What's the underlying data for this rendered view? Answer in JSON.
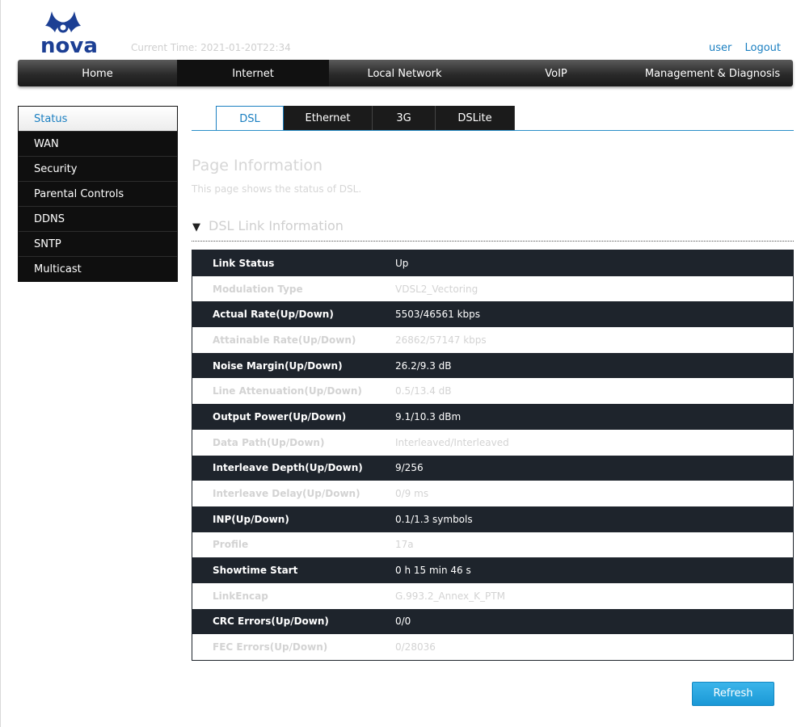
{
  "brand": {
    "logo_text": "nova"
  },
  "header": {
    "current_time": "Current Time: 2021-01-20T22:34",
    "user_label": "user",
    "logout_label": "Logout"
  },
  "topnav": {
    "tabs": [
      {
        "label": "Home"
      },
      {
        "label": "Internet"
      },
      {
        "label": "Local Network"
      },
      {
        "label": "VoIP"
      },
      {
        "label": "Management & Diagnosis"
      }
    ],
    "active_index": 1
  },
  "sidebar": {
    "items": [
      {
        "label": "Status"
      },
      {
        "label": "WAN"
      },
      {
        "label": "Security"
      },
      {
        "label": "Parental Controls"
      },
      {
        "label": "DDNS"
      },
      {
        "label": "SNTP"
      },
      {
        "label": "Multicast"
      }
    ],
    "active_index": 0
  },
  "subtabs": {
    "tabs": [
      {
        "label": "DSL"
      },
      {
        "label": "Ethernet"
      },
      {
        "label": "3G"
      },
      {
        "label": "DSLite"
      }
    ],
    "active_index": 0
  },
  "page": {
    "title": "Page Information",
    "description": "This page shows the status of DSL."
  },
  "section": {
    "title": "DSL Link Information",
    "rows": [
      {
        "label": "Link Status",
        "value": "Up"
      },
      {
        "label": "Modulation Type",
        "value": "VDSL2_Vectoring"
      },
      {
        "label": "Actual Rate(Up/Down)",
        "value": "5503/46561 kbps"
      },
      {
        "label": "Attainable Rate(Up/Down)",
        "value": "26862/57147 kbps"
      },
      {
        "label": "Noise Margin(Up/Down)",
        "value": "26.2/9.3 dB"
      },
      {
        "label": "Line Attenuation(Up/Down)",
        "value": "0.5/13.4 dB"
      },
      {
        "label": "Output Power(Up/Down)",
        "value": "9.1/10.3 dBm"
      },
      {
        "label": "Data Path(Up/Down)",
        "value": "Interleaved/Interleaved"
      },
      {
        "label": "Interleave Depth(Up/Down)",
        "value": "9/256"
      },
      {
        "label": "Interleave Delay(Up/Down)",
        "value": "0/9 ms"
      },
      {
        "label": "INP(Up/Down)",
        "value": "0.1/1.3 symbols"
      },
      {
        "label": "Profile",
        "value": "17a"
      },
      {
        "label": "Showtime Start",
        "value": "0 h 15 min 46 s"
      },
      {
        "label": "LinkEncap",
        "value": "G.993.2_Annex_K_PTM"
      },
      {
        "label": "CRC Errors(Up/Down)",
        "value": "0/0"
      },
      {
        "label": "FEC Errors(Up/Down)",
        "value": "0/28036"
      }
    ]
  },
  "actions": {
    "refresh_label": "Refresh"
  },
  "colors": {
    "accent": "#1a7fc1",
    "brand": "#1c3f94",
    "dark_row": "#1e242c",
    "button": "#1a98d6"
  }
}
